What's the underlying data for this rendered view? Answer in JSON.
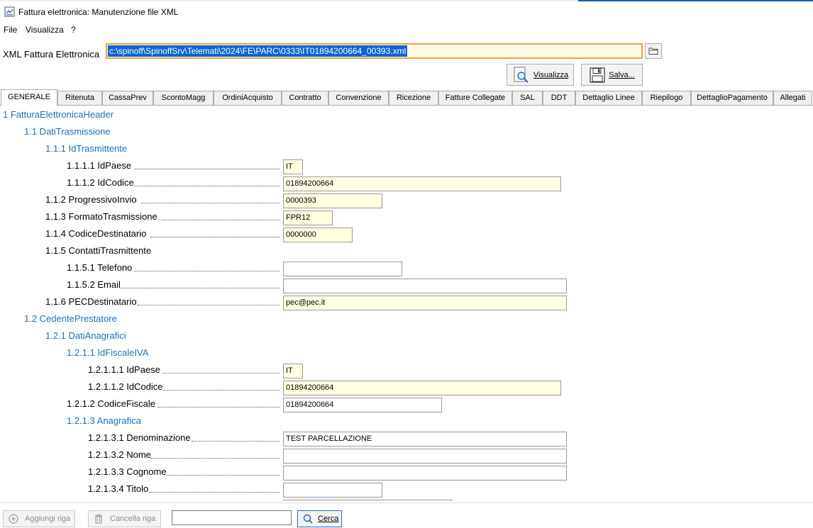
{
  "window": {
    "title": "Fattura elettronica: Manutenzione file XML"
  },
  "menu": {
    "items": [
      "File",
      "Visualizza",
      "?"
    ]
  },
  "path": {
    "label": "XML Fattura Elettronica",
    "value": "c:\\spinoff\\SpinoffSrv\\Telemati\\2024\\FE\\PARC\\0333\\IT01894200664_00393.xml"
  },
  "toolbar": {
    "visualizza_label": "Visualizza",
    "salva_label": "Salva..."
  },
  "tabs": [
    "GENERALE",
    "Ritenuta",
    "CassaPrev",
    "ScontoMagg",
    "OrdiniAcquisto",
    "Contratto",
    "Convenzione",
    "Ricezione",
    "Fatture Collegate",
    "SAL",
    "DDT",
    "Dettaglio Linee",
    "Riepilogo",
    "DettaglioPagamento",
    "Allegati"
  ],
  "tree": [
    {
      "label": "1 FatturaElettronicaHeader"
    },
    {
      "label": "1.1 DatiTrasmissione"
    },
    {
      "label": "1.1.1 IdTrasmittente"
    },
    {
      "label": "1.1.1.1 IdPaese",
      "value": "IT"
    },
    {
      "label": "1.1.1.2 IdCodice",
      "value": "01894200664"
    },
    {
      "label": "1.1.2 ProgressivoInvio",
      "value": "0000393"
    },
    {
      "label": "1.1.3 FormatoTrasmissione",
      "value": "FPR12"
    },
    {
      "label": "1.1.4 CodiceDestinatario",
      "value": "0000000"
    },
    {
      "label": "1.1.5 ContattiTrasmittente"
    },
    {
      "label": "1.1.5.1 Telefono",
      "value": ""
    },
    {
      "label": "1.1.5.2 Email",
      "value": ""
    },
    {
      "label": "1.1.6 PECDestinatario",
      "value": "pec@pec.it"
    },
    {
      "label": "1.2 CedentePrestatore"
    },
    {
      "label": "1.2.1 DatiAnagrafici"
    },
    {
      "label": "1.2.1.1 IdFiscaleIVA"
    },
    {
      "label": "1.2.1.1.1 IdPaese",
      "value": "IT"
    },
    {
      "label": "1.2.1.1.2 IdCodice",
      "value": "01894200664"
    },
    {
      "label": "1.2.1.2 CodiceFiscale",
      "value": "01894200664"
    },
    {
      "label": "1.2.1.3 Anagrafica"
    },
    {
      "label": "1.2.1.3.1 Denominazione",
      "value": "TEST PARCELLAZIONE"
    },
    {
      "label": "1.2.1.3.2 Nome",
      "value": ""
    },
    {
      "label": "1.2.1.3.3 Cognome",
      "value": ""
    },
    {
      "label": "1.2.1.3.4 Titolo",
      "value": ""
    }
  ],
  "bottom": {
    "aggiungi_label": "Aggiungi riga",
    "cancella_label": "Cancella riga",
    "cerca_label": "Cerca",
    "search_value": ""
  }
}
